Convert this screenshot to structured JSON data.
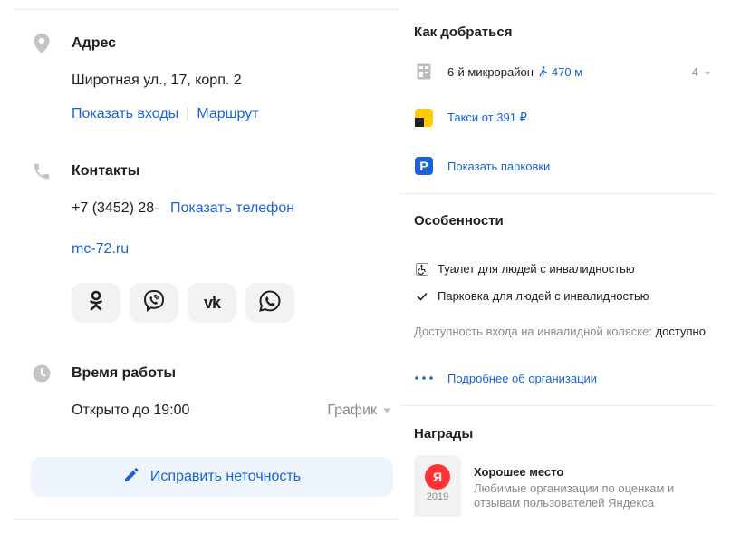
{
  "address": {
    "title": "Адрес",
    "value": "Широтная ул., 17, корп. 2",
    "show_entrances": "Показать входы",
    "route": "Маршрут"
  },
  "contacts": {
    "title": "Контакты",
    "phone_visible": "+7 (3452) 28",
    "phone_fade": "-",
    "show_phone": "Показать телефон",
    "website": "mc-72.ru",
    "socials": [
      "odnoklassniki-icon",
      "viber-icon",
      "vk-icon",
      "whatsapp-icon"
    ]
  },
  "hours": {
    "title": "Время работы",
    "status": "Открыто до 19:00",
    "schedule_label": "График"
  },
  "fix_button": {
    "label": "Исправить неточность"
  },
  "directions": {
    "title": "Как добраться",
    "transit_stop": "6-й микрорайон",
    "walk_distance": "470 м",
    "stop_count": "4",
    "taxi": "Такси от 391 ₽",
    "parking": "Показать парковки"
  },
  "features": {
    "title": "Особенности",
    "items": [
      "Туалет для людей с инвалидностью",
      "Парковка для людей с инвалидностью"
    ],
    "wheelchair_label": "Доступность входа на инвалидной коляске:",
    "wheelchair_value": "доступно",
    "more_about": "Подробнее об организации"
  },
  "awards": {
    "title": "Награды",
    "badge_letter": "Я",
    "badge_year": "2019",
    "award_title": "Хорошее место",
    "award_desc": "Любимые организации по оценкам и отзывам пользователей Яндекса"
  },
  "colors": {
    "link": "#1a62d6",
    "icon_gray": "#c4c4c4",
    "taxi_yellow": "#fc0",
    "parking_blue": "#1a62d6",
    "badge_red": "#f33"
  }
}
